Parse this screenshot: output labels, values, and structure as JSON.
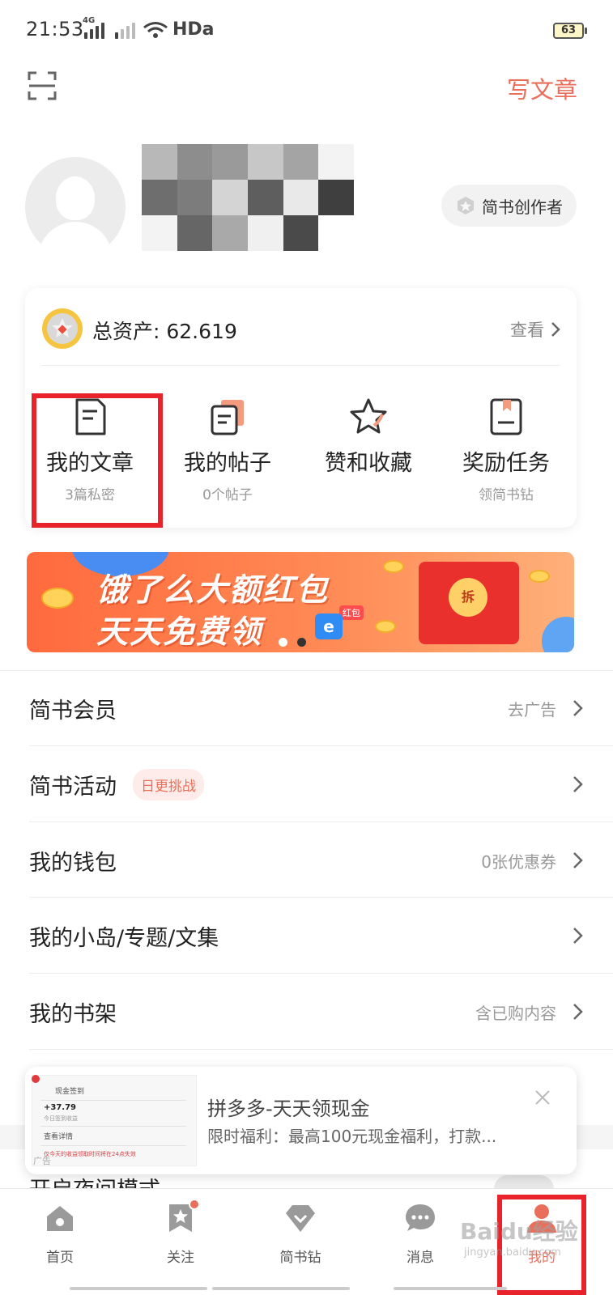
{
  "status_bar": {
    "time": "21:53",
    "network_tag": "4G",
    "hd_label": "HDa",
    "battery": "63"
  },
  "header": {
    "scan_icon": "scan-icon",
    "write_label": "写文章"
  },
  "profile": {
    "avatar_icon": "default-avatar-icon",
    "badge_label": "简书创作者"
  },
  "assets": {
    "label": "总资产: 62.619",
    "view_label": "查看"
  },
  "quick_actions": [
    {
      "title": "我的文章",
      "sub": "3篇私密",
      "icon": "article-icon"
    },
    {
      "title": "我的帖子",
      "sub": "0个帖子",
      "icon": "post-icon"
    },
    {
      "title": "赞和收藏",
      "sub": "",
      "icon": "star-icon"
    },
    {
      "title": "奖励任务",
      "sub": "领简书钻",
      "icon": "bookmark-book-icon"
    }
  ],
  "banner": {
    "line1": "饿了么大额红包",
    "line2": "天天免费领",
    "tag": "红包",
    "seal": "拆"
  },
  "menu": [
    {
      "label": "简书会员",
      "right": "去广告",
      "badge": ""
    },
    {
      "label": "简书活动",
      "right": "",
      "badge": "日更挑战"
    },
    {
      "label": "我的钱包",
      "right": "0张优惠券",
      "badge": ""
    },
    {
      "label": "我的小岛/专题/文集",
      "right": "",
      "badge": ""
    },
    {
      "label": "我的书架",
      "right": "含已购内容",
      "badge": ""
    }
  ],
  "under_item": "开启夜间模式",
  "ad": {
    "title": "拼多多-天天领现金",
    "desc": "限时福利：最高100元现金福利，打款...",
    "thumb_rows": [
      "现金签到",
      "+37.79",
      "今日签到收益",
      "查看详情",
      "仅今天的收益领取时间将在24点失效"
    ],
    "mark": "广告"
  },
  "bottom_nav": [
    {
      "label": "首页",
      "icon": "home-icon",
      "badge": false,
      "active": false
    },
    {
      "label": "关注",
      "icon": "follow-star-icon",
      "badge": true,
      "active": false
    },
    {
      "label": "简书钻",
      "icon": "diamond-icon",
      "badge": false,
      "active": false
    },
    {
      "label": "消息",
      "icon": "message-icon",
      "badge": false,
      "active": false
    },
    {
      "label": "我的",
      "icon": "profile-icon",
      "badge": true,
      "active": true
    }
  ],
  "watermark": {
    "main": "Baidu经验",
    "sub": "jingyan.baidu.com"
  },
  "colors": {
    "accent": "#ea6f5a",
    "highlight": "#e8232b",
    "banner": "#ff7a45"
  }
}
